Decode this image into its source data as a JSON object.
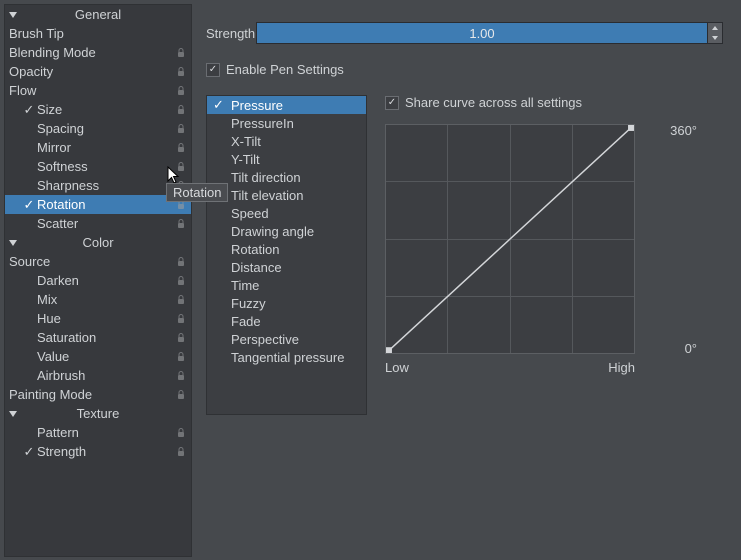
{
  "sidebar": {
    "sections": [
      {
        "title": "General",
        "items": [
          {
            "label": "Brush Tip",
            "indent": 0,
            "checked": false,
            "lock": false,
            "selected": false
          },
          {
            "label": "Blending Mode",
            "indent": 0,
            "checked": false,
            "lock": true,
            "selected": false
          },
          {
            "label": "Opacity",
            "indent": 0,
            "checked": false,
            "lock": true,
            "selected": false
          },
          {
            "label": "Flow",
            "indent": 0,
            "checked": false,
            "lock": true,
            "selected": false
          },
          {
            "label": "Size",
            "indent": 1,
            "checked": true,
            "lock": true,
            "selected": false
          },
          {
            "label": "Spacing",
            "indent": 1,
            "checked": false,
            "lock": true,
            "selected": false
          },
          {
            "label": "Mirror",
            "indent": 1,
            "checked": false,
            "lock": true,
            "selected": false
          },
          {
            "label": "Softness",
            "indent": 1,
            "checked": false,
            "lock": true,
            "selected": false
          },
          {
            "label": "Sharpness",
            "indent": 1,
            "checked": false,
            "lock": true,
            "selected": false
          },
          {
            "label": "Rotation",
            "indent": 1,
            "checked": true,
            "lock": true,
            "selected": true
          },
          {
            "label": "Scatter",
            "indent": 1,
            "checked": false,
            "lock": true,
            "selected": false
          }
        ]
      },
      {
        "title": "Color",
        "items": [
          {
            "label": "Source",
            "indent": 0,
            "checked": false,
            "lock": true,
            "selected": false
          },
          {
            "label": "Darken",
            "indent": 1,
            "checked": false,
            "lock": true,
            "selected": false
          },
          {
            "label": "Mix",
            "indent": 1,
            "checked": false,
            "lock": true,
            "selected": false
          },
          {
            "label": "Hue",
            "indent": 1,
            "checked": false,
            "lock": true,
            "selected": false
          },
          {
            "label": "Saturation",
            "indent": 1,
            "checked": false,
            "lock": true,
            "selected": false
          },
          {
            "label": "Value",
            "indent": 1,
            "checked": false,
            "lock": true,
            "selected": false
          },
          {
            "label": "Airbrush",
            "indent": 1,
            "checked": false,
            "lock": true,
            "selected": false
          },
          {
            "label": "Painting Mode",
            "indent": 0,
            "checked": false,
            "lock": true,
            "selected": false
          }
        ]
      },
      {
        "title": "Texture",
        "items": [
          {
            "label": "Pattern",
            "indent": 1,
            "checked": false,
            "lock": true,
            "selected": false
          },
          {
            "label": "Strength",
            "indent": 1,
            "checked": true,
            "lock": true,
            "selected": false
          }
        ]
      }
    ]
  },
  "main": {
    "strength_label": "Strength:",
    "strength_value": "1.00",
    "strength_fill_pct": 100,
    "enable_pen_label": "Enable Pen Settings",
    "enable_pen_checked": true,
    "share_curve_label": "Share curve across all settings",
    "share_curve_checked": true,
    "sensors": [
      {
        "label": "Pressure",
        "checked": true,
        "selected": true
      },
      {
        "label": "PressureIn",
        "checked": false,
        "selected": false
      },
      {
        "label": "X-Tilt",
        "checked": false,
        "selected": false
      },
      {
        "label": "Y-Tilt",
        "checked": false,
        "selected": false
      },
      {
        "label": "Tilt direction",
        "checked": false,
        "selected": false
      },
      {
        "label": "Tilt elevation",
        "checked": false,
        "selected": false
      },
      {
        "label": "Speed",
        "checked": false,
        "selected": false
      },
      {
        "label": "Drawing angle",
        "checked": false,
        "selected": false
      },
      {
        "label": "Rotation",
        "checked": false,
        "selected": false
      },
      {
        "label": "Distance",
        "checked": false,
        "selected": false
      },
      {
        "label": "Time",
        "checked": false,
        "selected": false
      },
      {
        "label": "Fuzzy",
        "checked": false,
        "selected": false
      },
      {
        "label": "Fade",
        "checked": false,
        "selected": false
      },
      {
        "label": "Perspective",
        "checked": false,
        "selected": false
      },
      {
        "label": "Tangential pressure",
        "checked": false,
        "selected": false
      }
    ],
    "curve": {
      "y_top": "360°",
      "y_bottom": "0°",
      "x_low": "Low",
      "x_high": "High"
    }
  },
  "tooltip": "Rotation",
  "chart_data": {
    "type": "line",
    "x": [
      0,
      1
    ],
    "y": [
      0,
      1
    ],
    "xlabel_low": "Low",
    "xlabel_high": "High",
    "ylim": [
      0,
      360
    ],
    "ylabel_unit": "°",
    "grid": true
  }
}
